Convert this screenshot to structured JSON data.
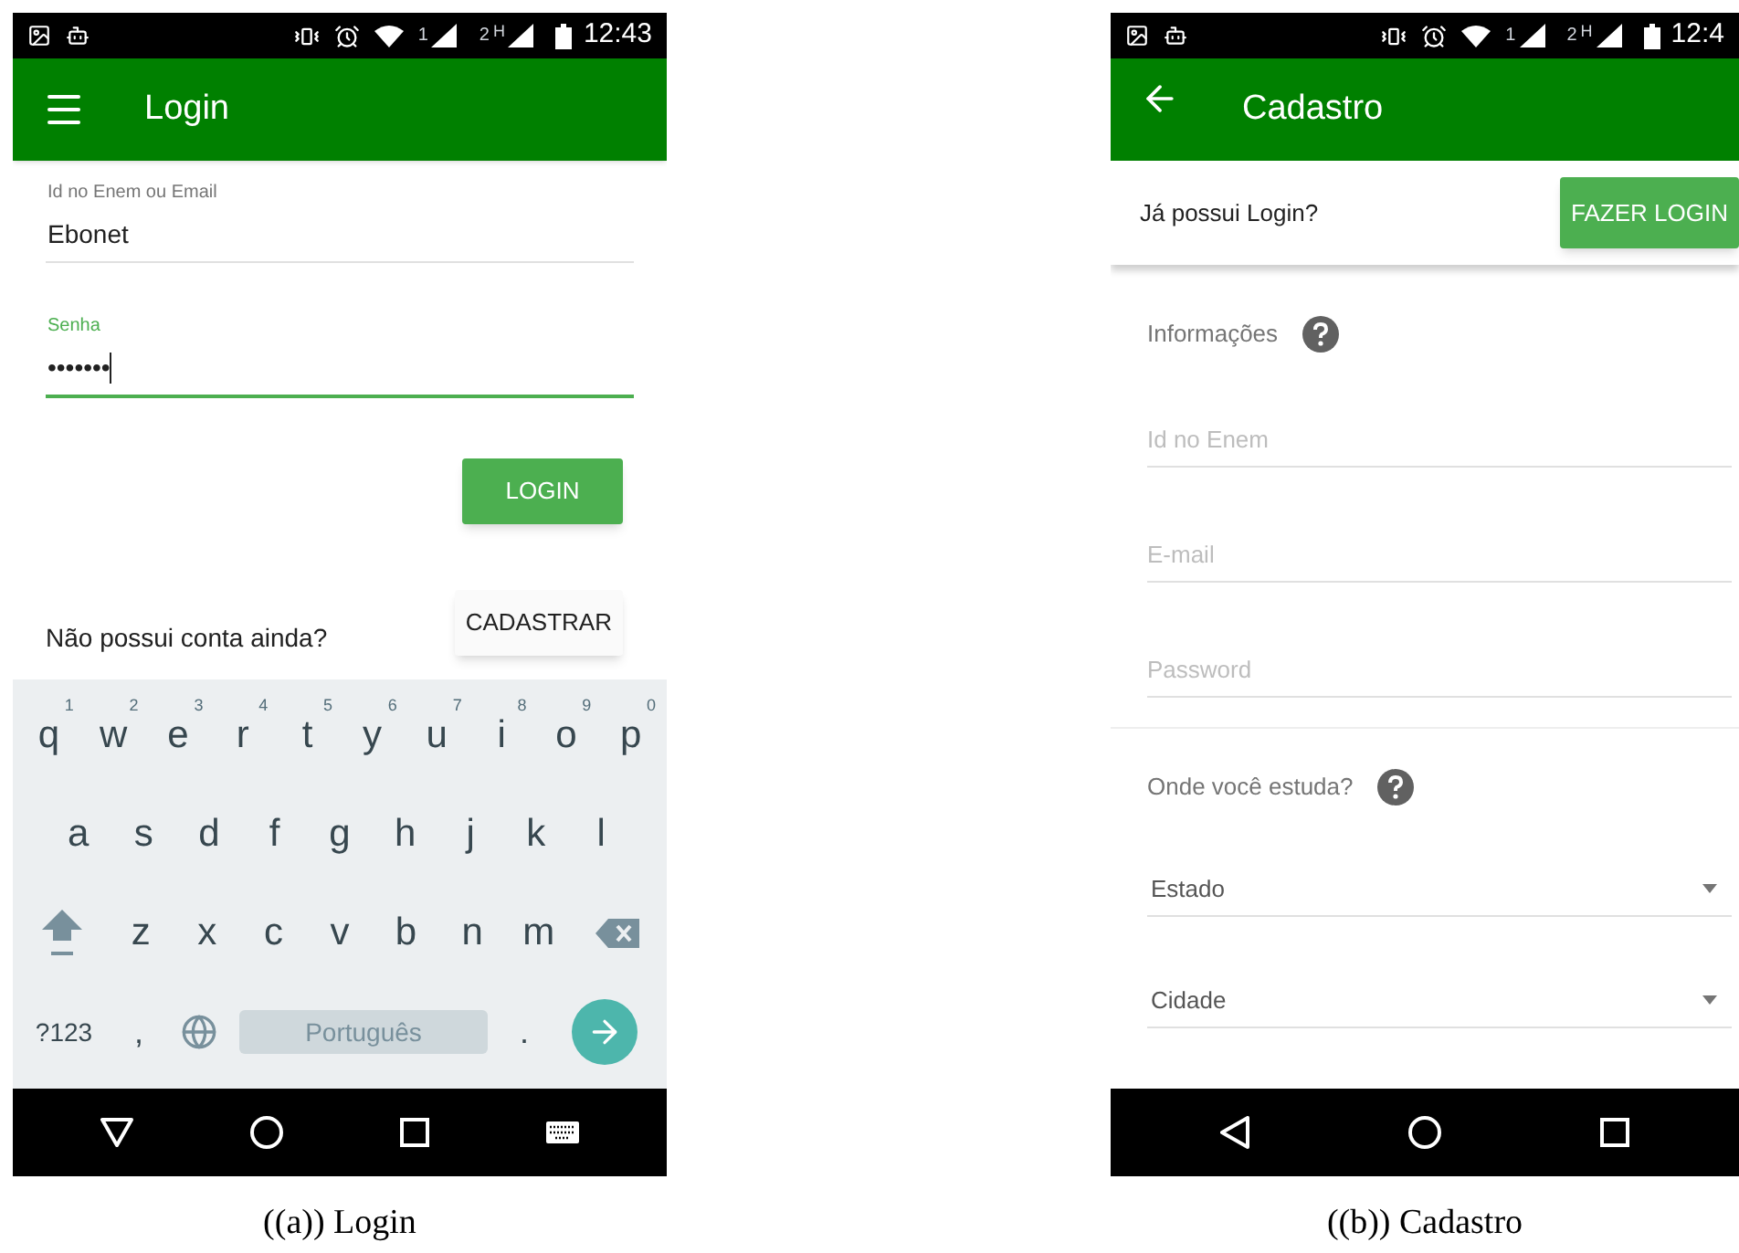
{
  "login_screen": {
    "status_bar": {
      "sim1": "1",
      "sim2": "2",
      "network": "H",
      "time": "12:43"
    },
    "app_bar": {
      "title": "Login",
      "kind": "menu"
    },
    "fields": [
      {
        "label": "Id no Enem ou Email",
        "value": "Ebonet",
        "focused": false
      },
      {
        "label": "Senha",
        "value": "•••••••",
        "focused": true
      }
    ],
    "login_button": "LOGIN",
    "signup_prompt": "Não possui conta ainda?",
    "signup_button": "CADASTRAR",
    "keyboard": {
      "rows": [
        [
          {
            "key": "q",
            "hint": "1"
          },
          {
            "key": "w",
            "hint": "2"
          },
          {
            "key": "e",
            "hint": "3"
          },
          {
            "key": "r",
            "hint": "4"
          },
          {
            "key": "t",
            "hint": "5"
          },
          {
            "key": "y",
            "hint": "6"
          },
          {
            "key": "u",
            "hint": "7"
          },
          {
            "key": "i",
            "hint": "8"
          },
          {
            "key": "o",
            "hint": "9"
          },
          {
            "key": "p",
            "hint": "0"
          }
        ],
        [
          {
            "key": "a"
          },
          {
            "key": "s"
          },
          {
            "key": "d"
          },
          {
            "key": "f"
          },
          {
            "key": "g"
          },
          {
            "key": "h"
          },
          {
            "key": "j"
          },
          {
            "key": "k"
          },
          {
            "key": "l"
          }
        ],
        [
          {
            "key": "z"
          },
          {
            "key": "x"
          },
          {
            "key": "c"
          },
          {
            "key": "v"
          },
          {
            "key": "b"
          },
          {
            "key": "n"
          },
          {
            "key": "m"
          }
        ]
      ],
      "symbols_key": "?123",
      "comma_key": ",",
      "space_key": "Português",
      "period_key": "."
    },
    "nav_bar": {
      "kind": "down",
      "keyboard_switch": true
    }
  },
  "register_screen": {
    "status_bar": {
      "sim1": "1",
      "sim2": "2",
      "network": "H",
      "time": "12:4"
    },
    "app_bar": {
      "title": "Cadastro",
      "kind": "back"
    },
    "login_prompt": "Já possui Login?",
    "login_button": "FAZER LOGIN",
    "sections": [
      {
        "title": "Informações",
        "fields": [
          {
            "kind": "text",
            "placeholder": "Id no Enem"
          },
          {
            "kind": "text",
            "placeholder": "E-mail"
          },
          {
            "kind": "text",
            "placeholder": "Password"
          }
        ]
      },
      {
        "title": "Onde você estuda?",
        "fields": [
          {
            "kind": "select",
            "value": "Estado"
          },
          {
            "kind": "select",
            "value": "Cidade"
          }
        ]
      }
    ],
    "nav_bar": {
      "kind": "left",
      "keyboard_switch": false
    }
  },
  "captions": [
    "((a)) Login",
    "((b)) Cadastro"
  ]
}
